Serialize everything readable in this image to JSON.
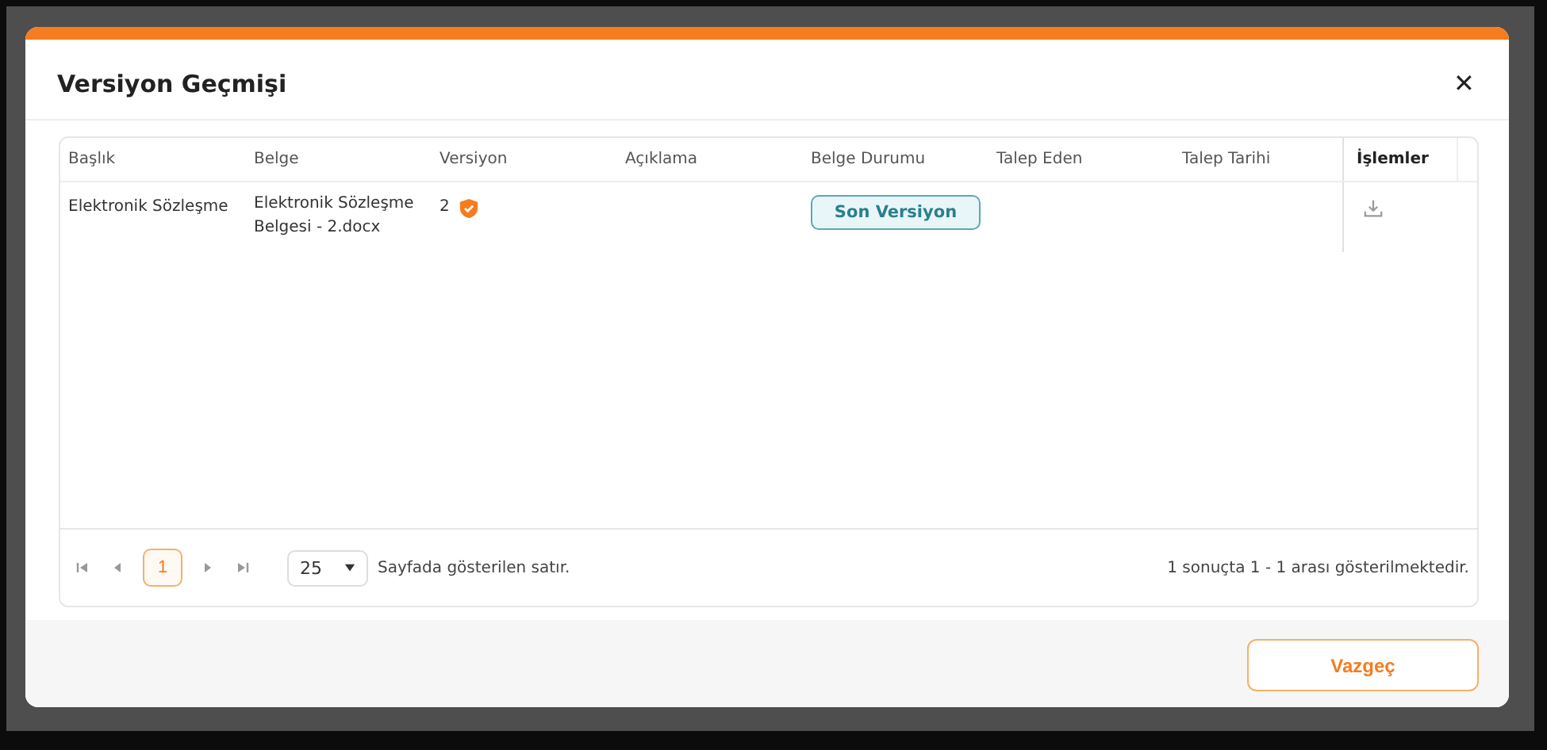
{
  "dialog": {
    "title": "Versiyon Geçmişi",
    "close": "✕"
  },
  "table": {
    "columns": [
      "Başlık",
      "Belge",
      "Versiyon",
      "Açıklama",
      "Belge Durumu",
      "Talep Eden",
      "Talep Tarihi"
    ],
    "actions_column": "İşlemler",
    "rows": [
      {
        "title": "Elektronik Sözleşme",
        "document": "Elektronik Sözleşme Belgesi - 2.docx",
        "version": "2",
        "verified": true,
        "status": "Son Versiyon"
      }
    ]
  },
  "pagination": {
    "pages": [
      {
        "label": "1",
        "selected": true
      }
    ],
    "page_size": "25",
    "page_size_label": "Sayfada gösterilen satır.",
    "summary": "1 sonuçta 1 - 1 arası gösterilmektedir."
  },
  "buttons": [
    "Vazgeç"
  ]
}
